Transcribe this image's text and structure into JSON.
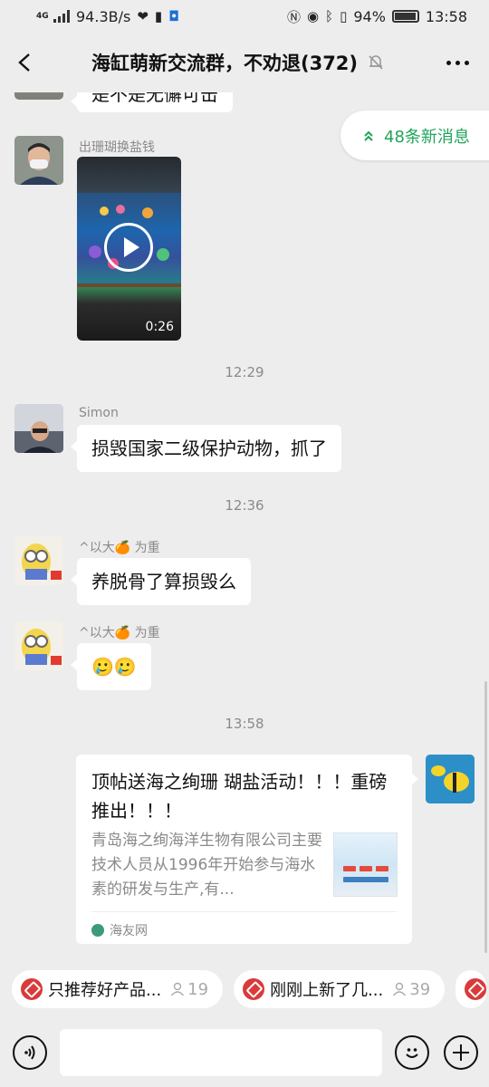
{
  "status_bar": {
    "network": "4G",
    "speed": "94.3B/s",
    "battery_percent": "94%",
    "time": "13:58"
  },
  "header": {
    "title": "海缸萌新交流群，不劝退(372)",
    "back_icon": "chevron-left-icon",
    "mute_icon": "bell-off-icon",
    "more_icon": "more-dots-icon"
  },
  "new_messages_pill": {
    "label": "48条新消息",
    "icon": "double-chevron-up-icon"
  },
  "messages": {
    "partial_top": {
      "text": "是不是无懈可击"
    },
    "video": {
      "sender": "出珊瑚换盐钱",
      "duration": "0:26"
    },
    "time1": "12:29",
    "simon": {
      "sender": "Simon",
      "text": "损毁国家二级保护动物，抓了"
    },
    "time2": "12:36",
    "yitai1": {
      "sender": "^以大🍊 为重",
      "text": "养脱骨了算损毁么"
    },
    "yitai2": {
      "sender": "^以大🍊 为重",
      "text": "🥲🥲"
    },
    "time3": "13:58",
    "card": {
      "title": "顶帖送海之绚珊 瑚盐活动！！！重磅推出！！！",
      "description": "青岛海之绚海洋生物有限公司主要技术人员从1996年开始参与海水素的研发与生产,有...",
      "source": "海友网"
    }
  },
  "chips": [
    {
      "label": "只推荐好产品...",
      "count": "19"
    },
    {
      "label": "刚刚上新了几...",
      "count": "39"
    }
  ],
  "input_bar": {
    "voice_icon": "voice-icon",
    "emoji_icon": "emoji-icon",
    "plus_icon": "plus-icon"
  },
  "colors": {
    "accent_green": "#1fa45a",
    "background": "#ededed",
    "bubble": "#ffffff"
  }
}
